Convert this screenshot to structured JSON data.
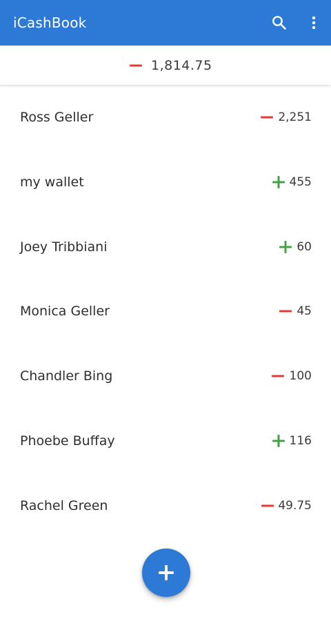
{
  "app": {
    "title": "iCashBook",
    "brand_color": "#2d7ad6",
    "icons": [
      "search-icon",
      "more-vert-icon",
      "add-icon"
    ]
  },
  "total": {
    "sign": "minus",
    "amount": "1,814.75",
    "sign_color": "#e53935"
  },
  "colors": {
    "negative": "#e53935",
    "positive": "#43a047"
  },
  "accounts": [
    {
      "name": "Ross Geller",
      "sign": "minus",
      "amount": "2,251"
    },
    {
      "name": "my wallet",
      "sign": "plus",
      "amount": "455"
    },
    {
      "name": "Joey Tribbiani",
      "sign": "plus",
      "amount": "60"
    },
    {
      "name": "Monica Geller",
      "sign": "minus",
      "amount": "45"
    },
    {
      "name": "Chandler Bing",
      "sign": "minus",
      "amount": "100"
    },
    {
      "name": "Phoebe Buffay",
      "sign": "plus",
      "amount": "116"
    },
    {
      "name": "Rachel Green",
      "sign": "minus",
      "amount": "49.75"
    }
  ]
}
